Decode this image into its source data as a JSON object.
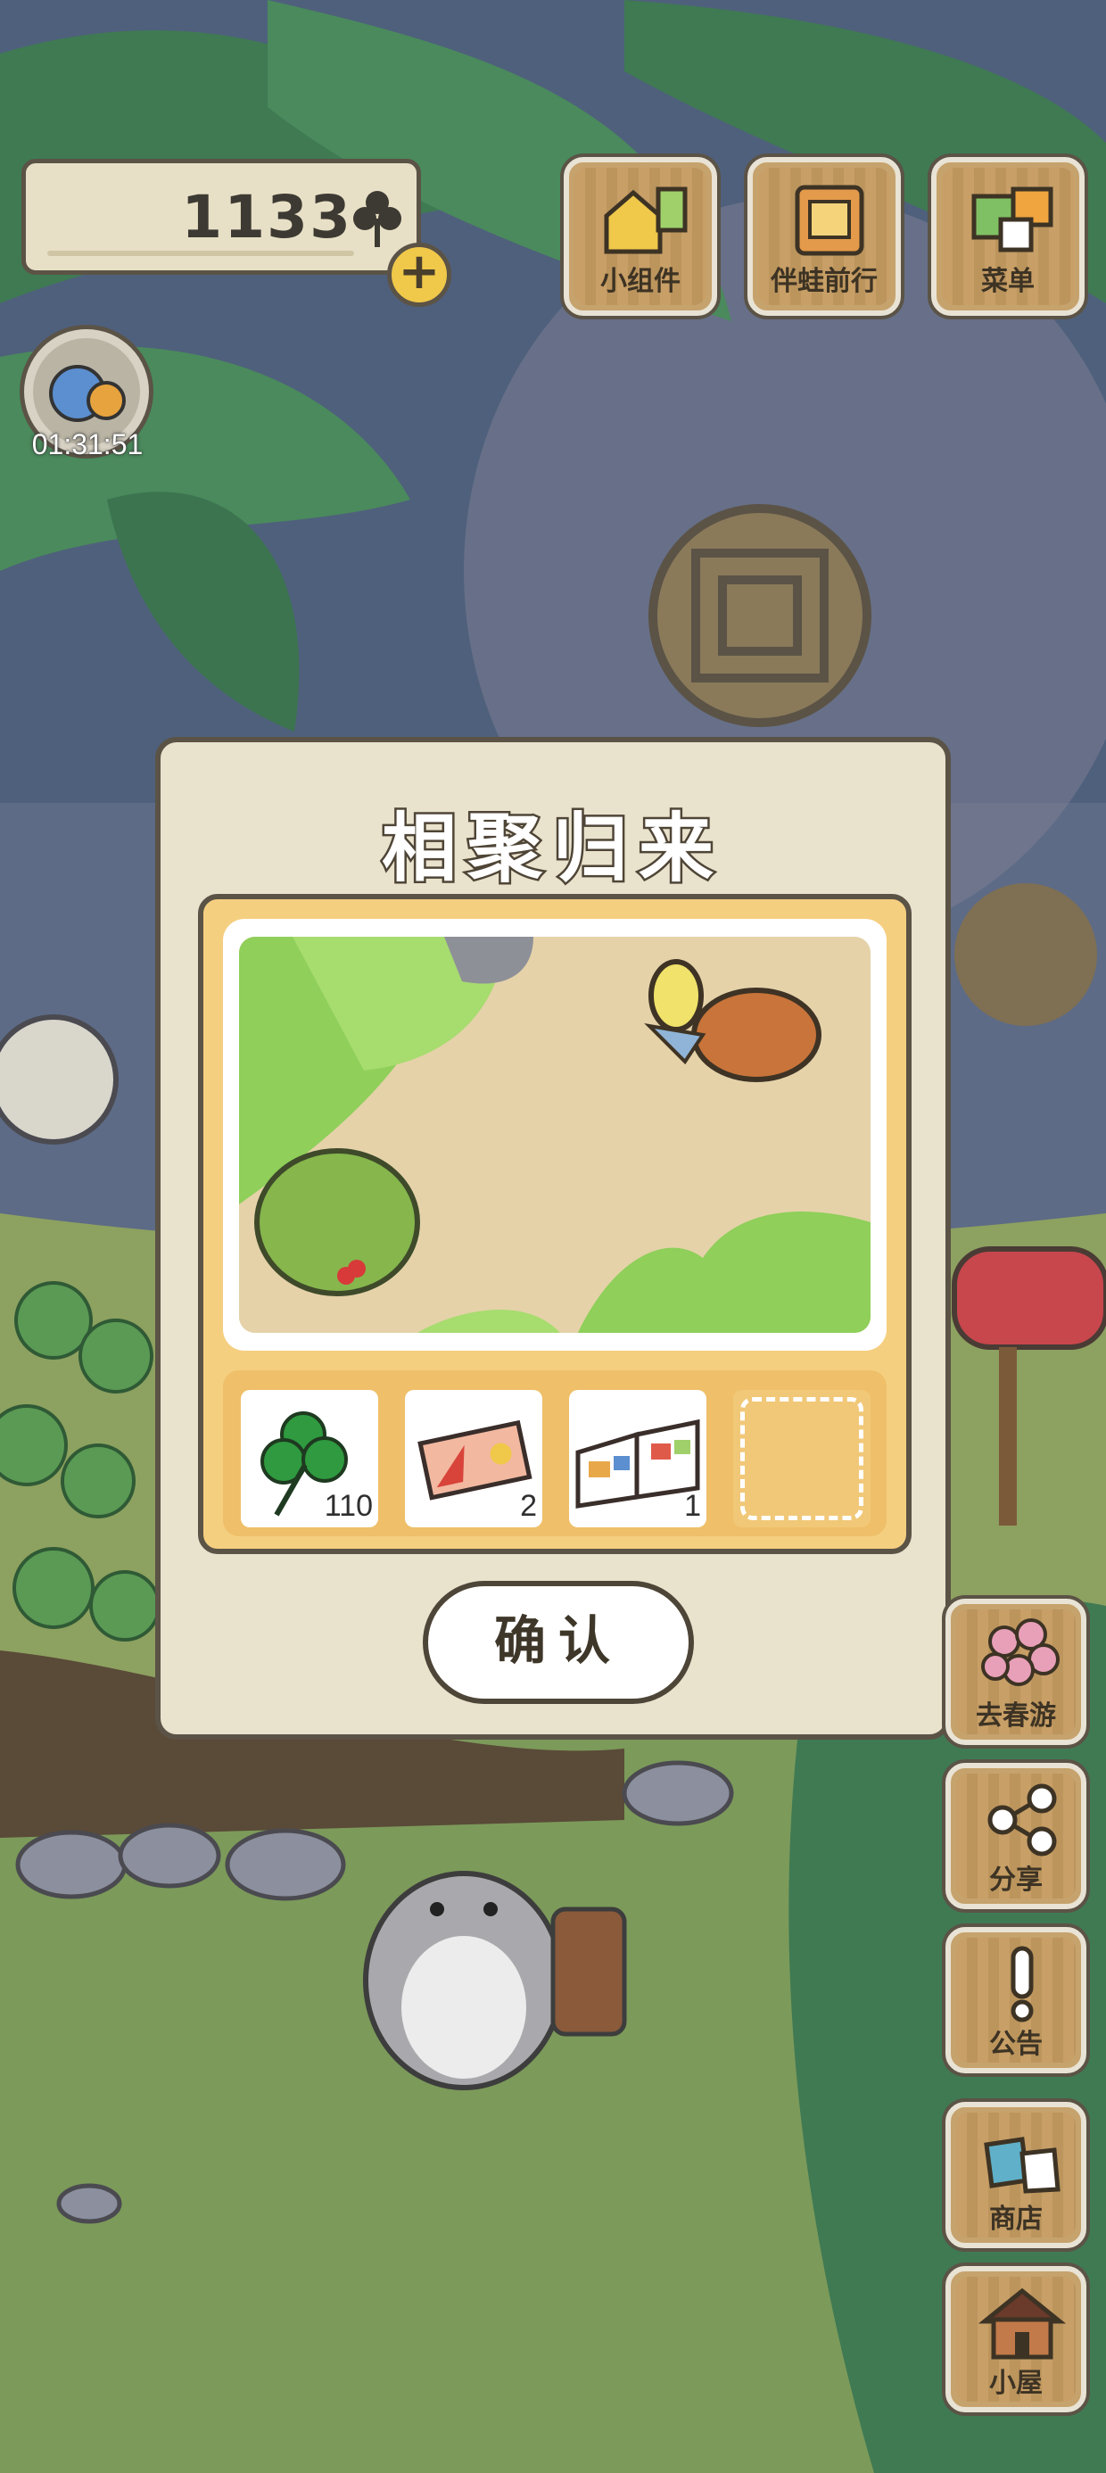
{
  "currency": {
    "count": "1133",
    "icon": "clover-icon",
    "add_icon": "plus-icon"
  },
  "traveler": {
    "timer": "01:31:51"
  },
  "top_buttons": [
    {
      "label": "小组件",
      "icon": "widget-icon"
    },
    {
      "label": "伴蛙前行",
      "icon": "journey-book-icon"
    },
    {
      "label": "菜单",
      "icon": "menu-cards-icon"
    }
  ],
  "dialog": {
    "title": "相聚归来",
    "items": [
      {
        "icon": "clover-icon",
        "quantity": "110"
      },
      {
        "icon": "ticket-icon",
        "quantity": "2"
      },
      {
        "icon": "brochure-icon",
        "quantity": "1"
      },
      {
        "icon": "empty-slot",
        "quantity": ""
      }
    ],
    "confirm_label": "确认"
  },
  "side_buttons": [
    {
      "label": "去春游",
      "icon": "blossom-icon"
    },
    {
      "label": "分享",
      "icon": "share-icon"
    },
    {
      "label": "公告",
      "icon": "exclamation-icon"
    },
    {
      "label": "商店",
      "icon": "shop-bags-icon"
    },
    {
      "label": "小屋",
      "icon": "house-icon"
    }
  ],
  "colors": {
    "panel": "#e9e2cc",
    "outline": "#5b5346",
    "card": "#f5cf80",
    "button_wood": "#c6a26c",
    "grass": "#8fbf5d"
  }
}
